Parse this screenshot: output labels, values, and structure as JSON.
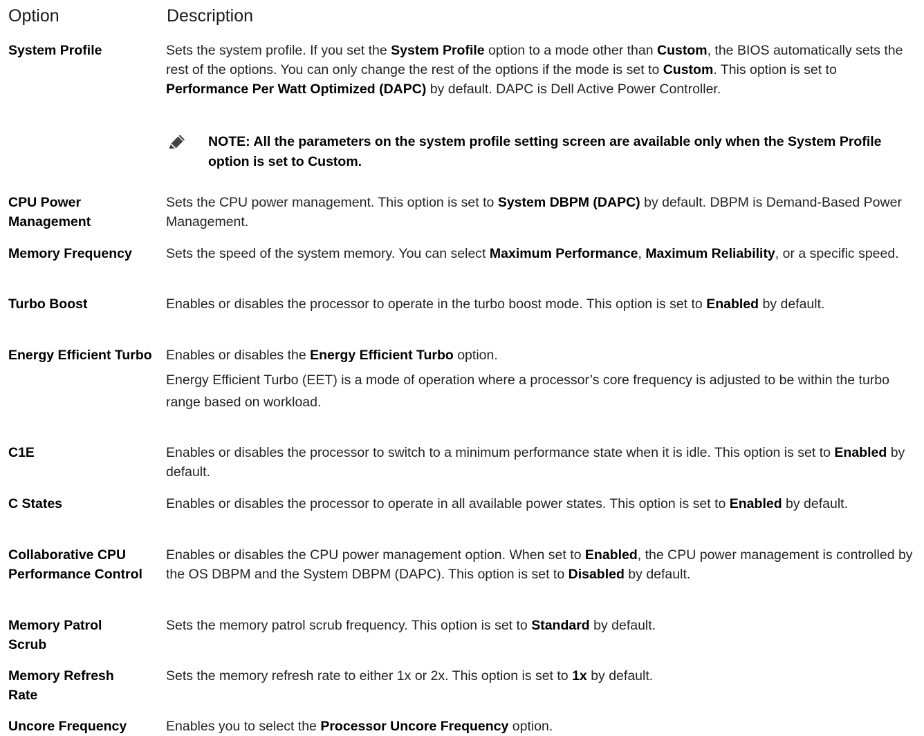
{
  "header": {
    "option": "Option",
    "description": "Description"
  },
  "rows": [
    {
      "option": "System Profile",
      "desc": [
        {
          "t": "Sets the system profile. If you set the "
        },
        {
          "t": "System Profile",
          "b": true
        },
        {
          "t": " option to a mode other than "
        },
        {
          "t": "Custom",
          "b": true
        },
        {
          "t": ", the BIOS automatically sets the rest of the options. You can only change the rest of the options if the mode is set to "
        },
        {
          "t": "Custom",
          "b": true
        },
        {
          "t": ". This option is set to "
        },
        {
          "t": "Performance Per Watt Optimized (DAPC)",
          "b": true
        },
        {
          "t": " by default. DAPC is Dell Active Power Controller."
        }
      ],
      "note": "NOTE: All the parameters on the system profile setting screen are available only when the System Profile option is set to Custom."
    },
    {
      "option": "CPU Power Management",
      "desc": [
        {
          "t": "Sets the CPU power management. This option is set to "
        },
        {
          "t": "System DBPM (DAPC)",
          "b": true
        },
        {
          "t": " by default. DBPM is Demand-Based Power Management."
        }
      ]
    },
    {
      "option": "Memory Frequency",
      "desc": [
        {
          "t": "Sets the speed of the system memory. You can select "
        },
        {
          "t": "Maximum Performance",
          "b": true
        },
        {
          "t": ", "
        },
        {
          "t": "Maximum Reliability",
          "b": true
        },
        {
          "t": ", or a specific speed."
        }
      ]
    },
    {
      "option": "Turbo Boost",
      "desc": [
        {
          "t": "Enables or disables the processor to operate in the turbo boost mode. This option is set to "
        },
        {
          "t": "Enabled",
          "b": true
        },
        {
          "t": " by default."
        }
      ]
    },
    {
      "option": "Energy Efficient Turbo",
      "desc": [
        {
          "t": "Enables or disables the "
        },
        {
          "t": "Energy Efficient Turbo",
          "b": true
        },
        {
          "t": " option."
        }
      ],
      "desc2": "Energy Efficient Turbo (EET) is a mode of operation where a processor’s core frequency is adjusted to be within the turbo range based on workload."
    },
    {
      "option": "C1E",
      "desc": [
        {
          "t": "Enables or disables the processor to switch to a minimum performance state when it is idle. This option is set to "
        },
        {
          "t": "Enabled",
          "b": true
        },
        {
          "t": " by default."
        }
      ]
    },
    {
      "option": "C States",
      "desc": [
        {
          "t": "Enables or disables the processor to operate in all available power states. This option is set to "
        },
        {
          "t": "Enabled",
          "b": true
        },
        {
          "t": " by default."
        }
      ]
    },
    {
      "option": "Collaborative CPU Performance Control",
      "desc": [
        {
          "t": "Enables or disables the CPU power management option. When set to "
        },
        {
          "t": "Enabled",
          "b": true
        },
        {
          "t": ", the CPU power management is controlled by the OS DBPM and the System DBPM (DAPC). This option is set to "
        },
        {
          "t": "Disabled",
          "b": true
        },
        {
          "t": " by default."
        }
      ]
    },
    {
      "option": "Memory Patrol Scrub",
      "desc": [
        {
          "t": "Sets the memory patrol scrub frequency. This option is set to "
        },
        {
          "t": "Standard",
          "b": true
        },
        {
          "t": " by default."
        }
      ]
    },
    {
      "option": "Memory Refresh Rate",
      "desc": [
        {
          "t": "Sets the memory refresh rate to either 1x or 2x. This option is set to "
        },
        {
          "t": "1x",
          "b": true
        },
        {
          "t": " by default."
        }
      ]
    },
    {
      "option": "Uncore Frequency",
      "desc": [
        {
          "t": "Enables you to select the "
        },
        {
          "t": "Processor Uncore Frequency",
          "b": true
        },
        {
          "t": " option."
        }
      ]
    }
  ]
}
